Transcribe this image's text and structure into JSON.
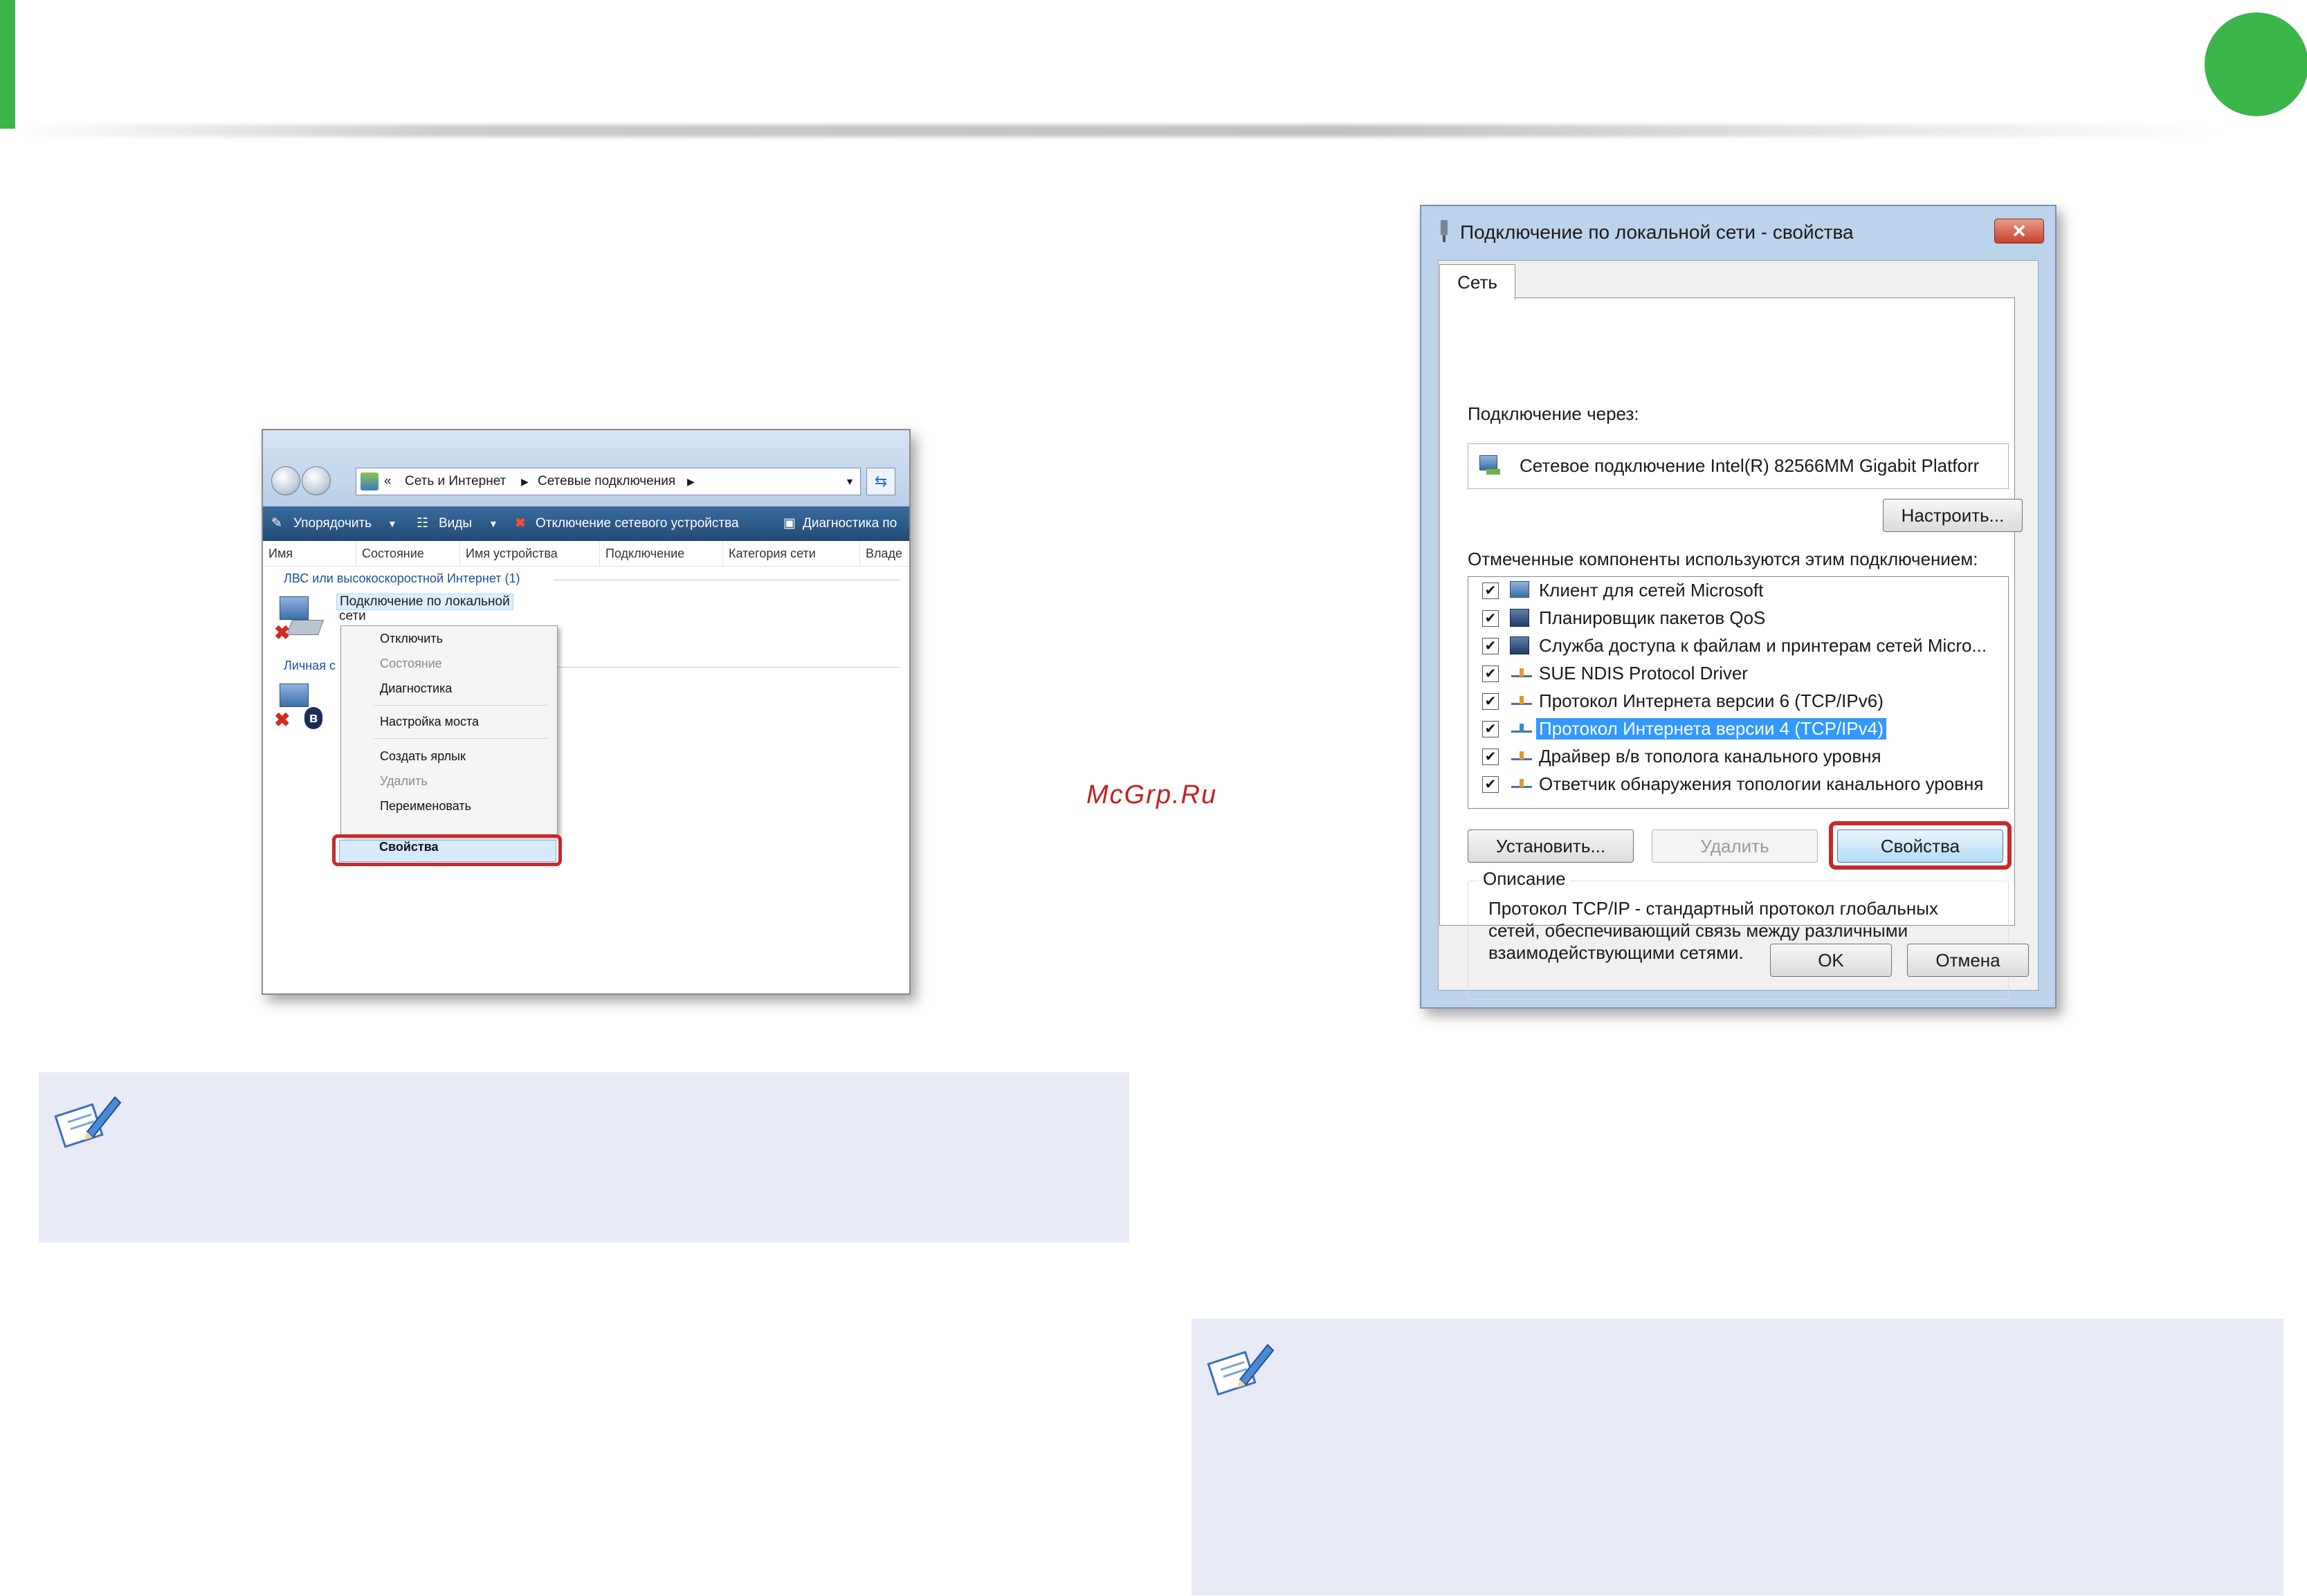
{
  "explorer": {
    "address": {
      "prefix": "«",
      "crumb1": "Сеть и Интернет",
      "crumb2": "Сетевые подключения"
    },
    "toolbar": {
      "organize": "Упорядочить",
      "views": "Виды",
      "disconnect": "Отключение сетевого устройства",
      "diagnostics": "Диагностика по"
    },
    "columns": [
      "Имя",
      "Состояние",
      "Имя устройства",
      "Подключение",
      "Категория сети",
      "Владе"
    ],
    "group1": "ЛВС или высокоскоростной Интернет (1)",
    "connection_name_line1": "Подключение по локальной",
    "connection_name_line2": "сети",
    "group2_partial": "Личная с",
    "context_menu": {
      "disconnect": "Отключить",
      "status": "Состояние",
      "diagnose": "Диагностика",
      "bridge": "Настройка моста",
      "shortcut": "Создать ярлык",
      "delete": "Удалить",
      "rename": "Переименовать",
      "properties": "Свойства"
    }
  },
  "watermark": "McGrp.Ru",
  "dialog": {
    "title": "Подключение по локальной сети - свойства",
    "close_glyph": "✕",
    "tab": "Сеть",
    "connect_via_label": "Подключение через:",
    "adapter": "Сетевое подключение Intel(R) 82566MM Gigabit Platforr",
    "configure_btn": "Настроить...",
    "components_label": "Отмеченные компоненты используются этим подключением:",
    "components": [
      {
        "label": "Клиент для сетей Microsoft",
        "checked": true,
        "icon": "network-client-icon"
      },
      {
        "label": "Планировщик пакетов QoS",
        "checked": true,
        "icon": "network-service-icon"
      },
      {
        "label": "Служба доступа к файлам и принтерам сетей Micro...",
        "checked": true,
        "icon": "network-service-icon"
      },
      {
        "label": "SUE NDIS Protocol Driver",
        "checked": true,
        "icon": "protocol-icon"
      },
      {
        "label": "Протокол Интернета версии 6 (TCP/IPv6)",
        "checked": true,
        "icon": "protocol-icon"
      },
      {
        "label": "Протокол Интернета версии 4 (TCP/IPv4)",
        "checked": true,
        "icon": "protocol-icon",
        "selected": true
      },
      {
        "label": "Драйвер в/в тополога канального уровня",
        "checked": true,
        "icon": "protocol-icon"
      },
      {
        "label": "Ответчик обнаружения топологии канального уровня",
        "checked": true,
        "icon": "protocol-icon"
      }
    ],
    "install_btn": "Установить...",
    "uninstall_btn": "Удалить",
    "properties_btn": "Свойства",
    "description_legend": "Описание",
    "description_text": "Протокол TCP/IP - стандартный протокол глобальных сетей, обеспечивающий связь между различными взаимодействующими сетями.",
    "ok_btn": "OK",
    "cancel_btn": "Отмена"
  },
  "colors": {
    "accent_green": "#3cb54a",
    "highlight_red": "#c8292c",
    "note_background": "#e8eaf6",
    "selection_blue": "#3399ff"
  },
  "checkmark_glyph": "✔"
}
